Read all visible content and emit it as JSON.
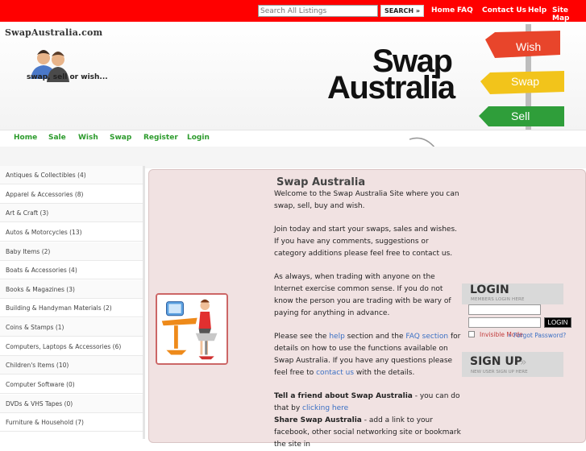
{
  "topbar": {
    "search_placeholder": "Search All Listings",
    "search_button": "SEARCH  »",
    "links": [
      "Home",
      "FAQ",
      "Contact Us",
      "Help",
      "Site Map"
    ]
  },
  "header": {
    "logo": "SwapAustralia.com",
    "tagline": "swap, sell or wish...",
    "brand_line1": "Swap",
    "brand_line2": "Australia",
    "signs": [
      "Wish",
      "Swap",
      "Sell"
    ]
  },
  "nav": [
    "Home",
    "Sale",
    "Wish",
    "Swap",
    "Register",
    "Login"
  ],
  "categories": [
    "Antiques & Collectibles (4)",
    "Apparel & Accessories (8)",
    "Art & Craft (3)",
    "Autos & Motorcycles (13)",
    "Baby Items (2)",
    "Boats & Accessories (4)",
    "Books & Magazines (3)",
    "Building & Handyman Materials (2)",
    "Coins & Stamps (1)",
    "Computers, Laptops & Accessories (6)",
    "Children's Items (10)",
    "Computer Software (0)",
    "DVDs & VHS Tapes (0)",
    "Furniture & Household (7)"
  ],
  "main": {
    "title": "Swap Australia",
    "welcome": "Welcome to the Swap Australia Site where you can swap, sell, buy and wish.",
    "join": "Join today and start your swaps, sales and wishes. If you have any comments, suggestions or category additions please feel free to contact us.",
    "caution": "As always, when trading with anyone on the Internet exercise common sense. If you do not know the person you are trading with be wary of paying for anything in advance.",
    "help_1": "Please see the ",
    "help_link": "help",
    "help_2": " section and the ",
    "faq_link": "FAQ section",
    "help_3": " for details on how to use the functions available on Swap Australia. If you have any questions please feel free to ",
    "contact_link": "contact us",
    "help_4": " with the details.",
    "tell_bold": "Tell a friend about Swap Australia",
    "tell_rest": " - you can do that by ",
    "tell_link": "clicking here",
    "share_bold": "Share Swap Australia",
    "share_rest": " - add a link to your facebook, other social networking site or bookmark the site in"
  },
  "login": {
    "title": "LOGIN",
    "subtitle": "MEMBERS LOGIN HERE",
    "button": "LOGIN",
    "invisible": "Invisible Mode",
    "forgot": "» Forgot Password?",
    "signup_title": "SIGN UP",
    "signup_subtitle": "NEW USER SIGN UP HERE"
  },
  "colors": {
    "topbar": "#ff0000",
    "nav_link": "#2c9b2c",
    "panel_bg": "#f1e2e2",
    "link": "#3b70c4",
    "sign_wish": "#e8452b",
    "sign_swap": "#f2c41b",
    "sign_sell": "#2f9e3a"
  }
}
